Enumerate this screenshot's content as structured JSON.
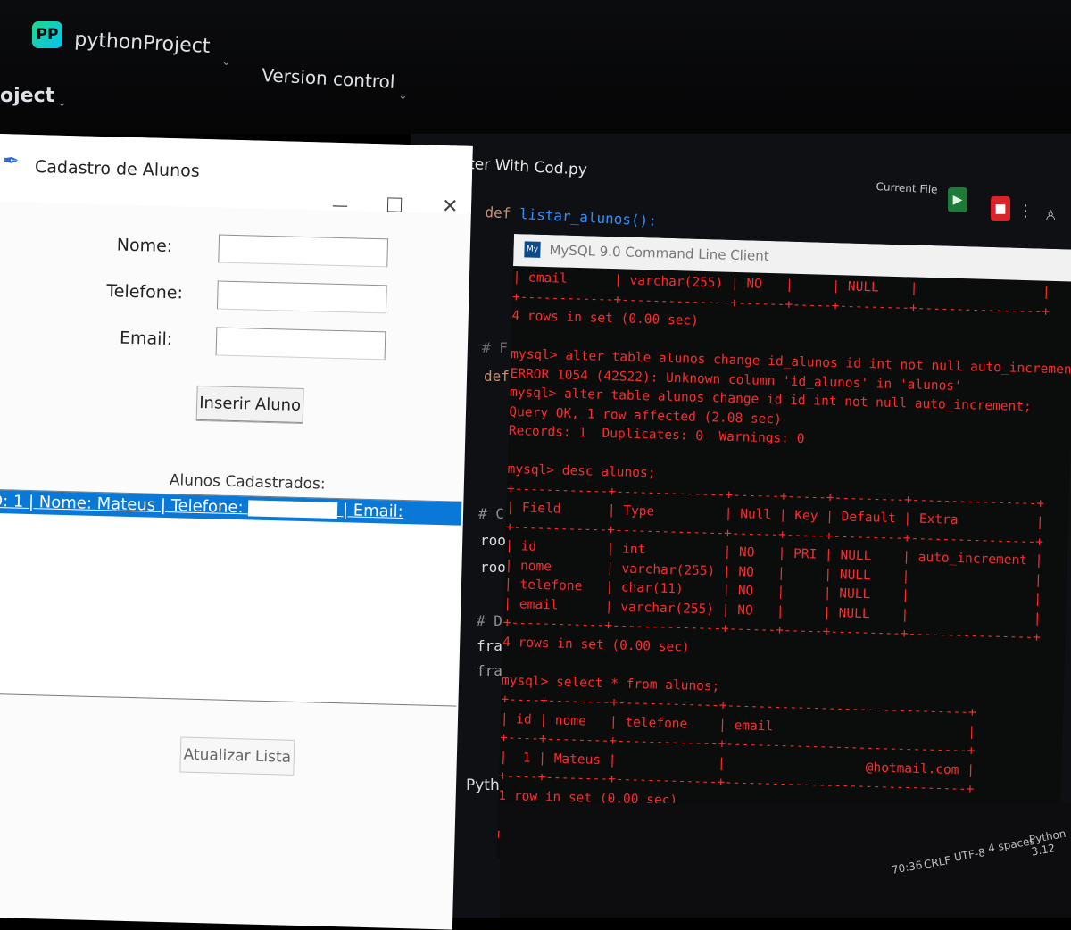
{
  "ide": {
    "logo": "PP",
    "project_name": "pythonProject",
    "version_control": "Version control",
    "project_panel": "oject",
    "tab_title": "Tkinter With Cod.py",
    "run_config": "Current File",
    "code_def": "def",
    "code_func": "listar_alunos",
    "code_paren": "():",
    "code_left_fragments": [
      "# F",
      "def",
      "# C",
      "roo",
      "roo",
      "# D",
      "fra",
      "fra",
      "Pyth"
    ]
  },
  "tk": {
    "title": "Cadastro de Alunos",
    "labels": {
      "nome": "Nome:",
      "telefone": "Telefone:",
      "email": "Email:"
    },
    "button_insert": "Inserir Aluno",
    "list_title": "Alunos Cadastrados:",
    "list_row": {
      "prefix": "D: 1 | Nome: Mateus | Telefone: ",
      "suffix": " | Email:"
    },
    "button_refresh": "Atualizar Lista"
  },
  "mysql": {
    "title": "MySQL 9.0 Command Line Client",
    "lines": [
      "| email      | varchar(255) | NO   |     | NULL    |                |",
      "+------------+--------------+------+-----+---------+----------------+",
      "4 rows in set (0.00 sec)",
      "",
      "mysql> alter table alunos change id_alunos id int not null auto_increment;",
      "ERROR 1054 (42S22): Unknown column 'id_alunos' in 'alunos'",
      "mysql> alter table alunos change id id int not null auto_increment;",
      "Query OK, 1 row affected (2.08 sec)",
      "Records: 1  Duplicates: 0  Warnings: 0",
      "",
      "mysql> desc alunos;",
      "+------------+--------------+------+-----+---------+----------------+",
      "| Field      | Type         | Null | Key | Default | Extra          |",
      "+------------+--------------+------+-----+---------+----------------+",
      "| id         | int          | NO   | PRI | NULL    | auto_increment |",
      "| nome       | varchar(255) | NO   |     | NULL    |                |",
      "| telefone   | char(11)     | NO   |     | NULL    |                |",
      "| email      | varchar(255) | NO   |     | NULL    |                |",
      "+------------+--------------+------+-----+---------+----------------+",
      "4 rows in set (0.00 sec)",
      "",
      "mysql> select * from alunos;",
      "+----+--------+-------------+-------------------------------+",
      "| id | nome   | telefone    | email                         |",
      "+----+--------+-------------+-------------------------------+",
      "|  1 | Mateus |             |                  @hotmail.com |",
      "+----+--------+-------------+-------------------------------+",
      "1 row in set (0.00 sec)",
      "",
      "mysql>"
    ]
  },
  "status": {
    "position": "70:36",
    "line_ending": "CRLF",
    "encoding": "UTF-8",
    "indent": "4 spaces",
    "interpreter": "Python 3.12"
  },
  "colors": {
    "mysql_text": "#ff2a2a",
    "selection": "#0a78d7",
    "run_green": "#1f7a3a",
    "stop_red": "#d8232a"
  }
}
